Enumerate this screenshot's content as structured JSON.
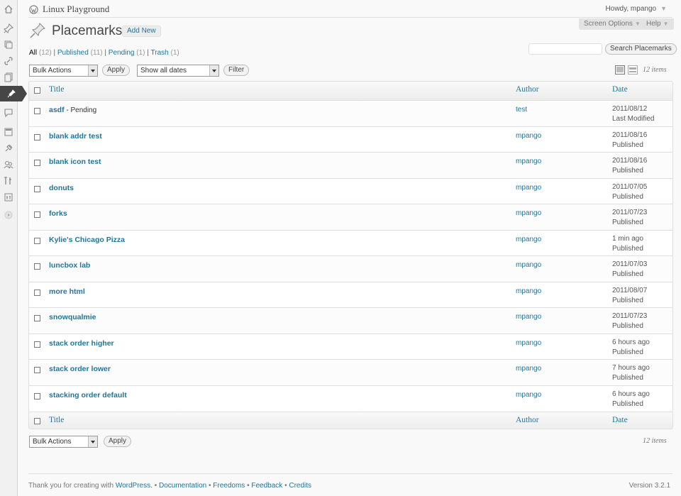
{
  "header": {
    "site_title": "Linux Playground",
    "howdy": "Howdy, mpango",
    "screen_options": "Screen Options",
    "help": "Help"
  },
  "page": {
    "title": "Placemarks",
    "add_new": "Add New"
  },
  "filters": {
    "all": "All",
    "all_count": "(12)",
    "published": "Published",
    "published_count": "(11)",
    "pending": "Pending",
    "pending_count": "(1)",
    "trash": "Trash",
    "trash_count": "(1)",
    "separator": "|"
  },
  "search": {
    "button": "Search Placemarks"
  },
  "toolbar": {
    "bulk_actions": "Bulk Actions",
    "apply": "Apply",
    "show_dates": "Show all dates",
    "filter": "Filter",
    "items": "12 items"
  },
  "table": {
    "headers": {
      "title": "Title",
      "author": "Author",
      "date": "Date"
    },
    "rows": [
      {
        "title": "asdf",
        "state": " - Pending",
        "author": "test",
        "date": "2011/08/12",
        "status": "Last Modified"
      },
      {
        "title": "blank addr test",
        "state": "",
        "author": "mpango",
        "date": "2011/08/16",
        "status": "Published"
      },
      {
        "title": "blank icon test",
        "state": "",
        "author": "mpango",
        "date": "2011/08/16",
        "status": "Published"
      },
      {
        "title": "donuts",
        "state": "",
        "author": "mpango",
        "date": "2011/07/05",
        "status": "Published"
      },
      {
        "title": "forks",
        "state": "",
        "author": "mpango",
        "date": "2011/07/23",
        "status": "Published"
      },
      {
        "title": "Kylie's Chicago Pizza",
        "state": "",
        "author": "mpango",
        "date": "1 min ago",
        "status": "Published"
      },
      {
        "title": "luncbox lab",
        "state": "",
        "author": "mpango",
        "date": "2011/07/03",
        "status": "Published"
      },
      {
        "title": "more html",
        "state": "",
        "author": "mpango",
        "date": "2011/08/07",
        "status": "Published"
      },
      {
        "title": "snowqualmie",
        "state": "",
        "author": "mpango",
        "date": "2011/07/23",
        "status": "Published"
      },
      {
        "title": "stack order higher",
        "state": "",
        "author": "mpango",
        "date": "6 hours ago",
        "status": "Published"
      },
      {
        "title": "stack order lower",
        "state": "",
        "author": "mpango",
        "date": "7 hours ago",
        "status": "Published"
      },
      {
        "title": "stacking order default",
        "state": "",
        "author": "mpango",
        "date": "6 hours ago",
        "status": "Published"
      }
    ]
  },
  "footer": {
    "thanks": "Thank you for creating with ",
    "wordpress": "WordPress.",
    "bullet": " • ",
    "documentation": "Documentation",
    "freedoms": "Freedoms",
    "feedback": "Feedback",
    "credits": "Credits",
    "version": "Version 3.2.1"
  },
  "icons": {
    "menu": [
      "dashboard-icon",
      "posts-icon",
      "media-icon",
      "links-icon",
      "pages-icon",
      "placemarks-icon",
      "comments-icon",
      "appearance-icon",
      "plugins-icon",
      "users-icon",
      "tools-icon",
      "settings-icon",
      "collapse-icon"
    ],
    "accent": "#21759b"
  }
}
